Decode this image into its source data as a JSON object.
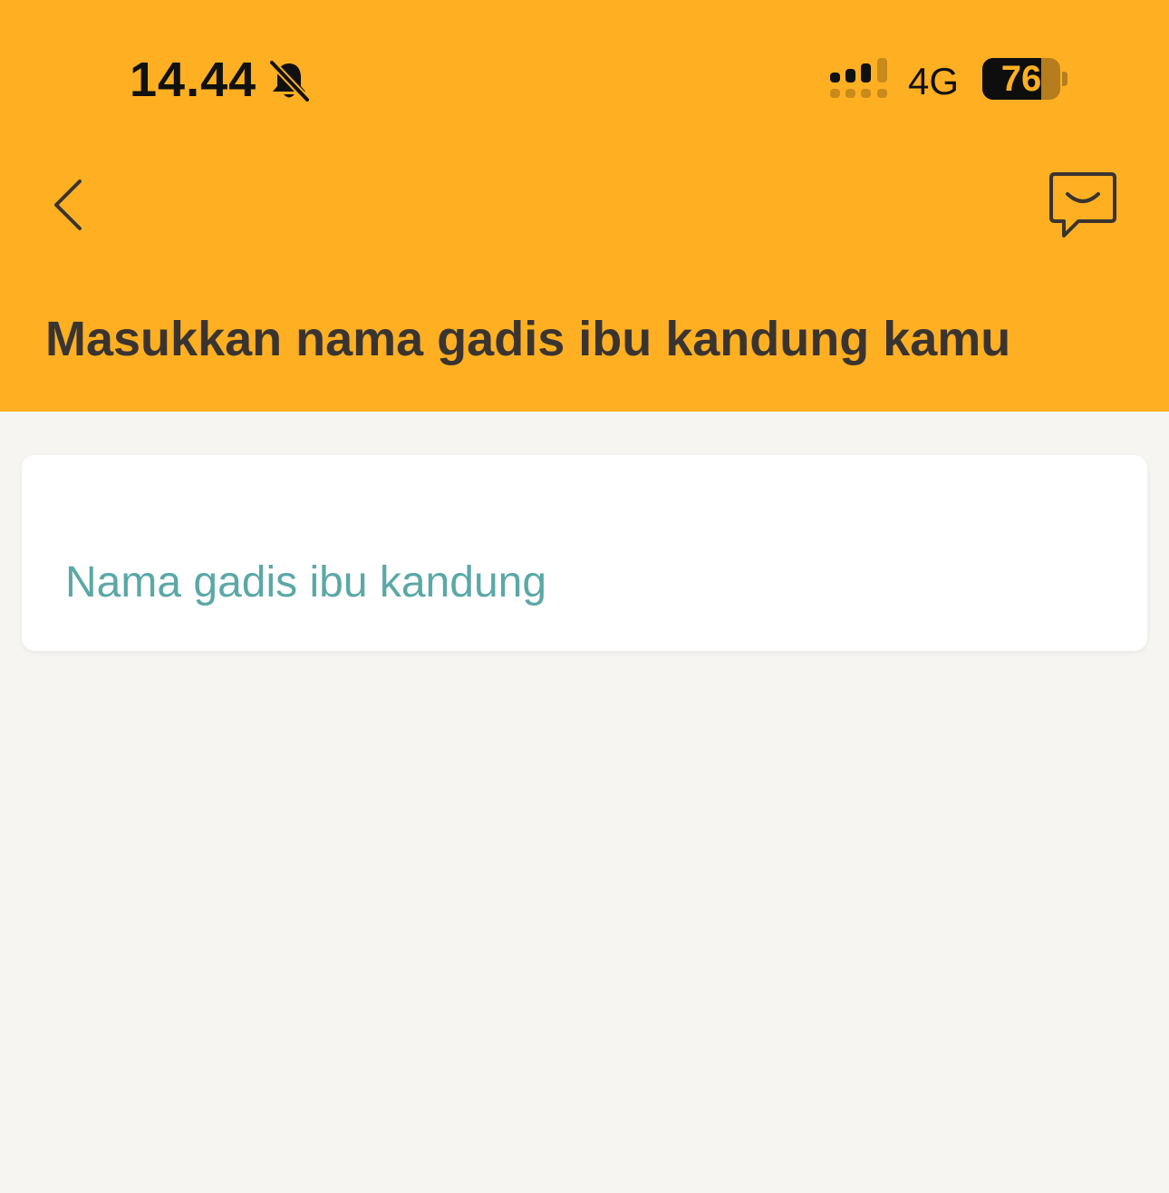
{
  "status_bar": {
    "time": "14.44",
    "network": "4G",
    "battery_level": "76",
    "battery_fraction": 0.76
  },
  "icons": {
    "bell": "bell-slash-icon",
    "signal": "cellular-signal-icon",
    "back": "chevron-left-icon",
    "chat": "chat-bubble-icon"
  },
  "header": {
    "title": "Masukkan nama gadis ibu kandung kamu"
  },
  "form": {
    "mother_name": {
      "value": "",
      "placeholder": "Nama gadis ibu kandung"
    }
  },
  "colors": {
    "header_background": "#ffb022",
    "page_background": "#f6f5f2",
    "placeholder": "#5ba8a6",
    "title_text": "#3a3430"
  }
}
